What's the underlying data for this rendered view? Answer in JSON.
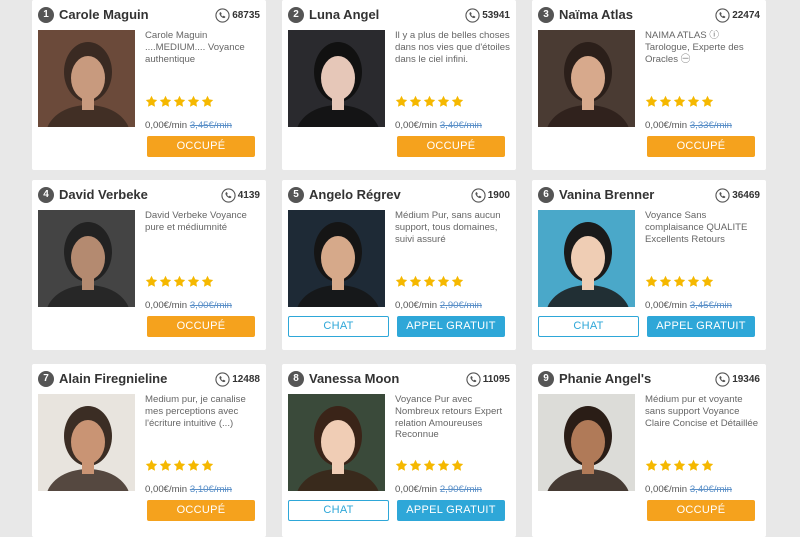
{
  "colors": {
    "busy": "#f5a21d",
    "free": "#2ea7d8",
    "star": "#f5b800",
    "old_price": "#5b90c8"
  },
  "icons": {
    "calls": "phone-icon",
    "rating": "star-icon",
    "rank": "rank-badge"
  },
  "cards": [
    {
      "rank": "1",
      "name": "Carole Maguin",
      "calls": "68735",
      "desc": "Carole Maguin ....MEDIUM.... Voyance authentique",
      "rating": 5,
      "price": "0,00€/min",
      "old_price": "3,45€/min",
      "status": "busy",
      "busy_label": "OCCUPÉ",
      "chat_label": "",
      "free_label": ""
    },
    {
      "rank": "2",
      "name": "Luna Angel",
      "calls": "53941",
      "desc": "Il y a plus de belles choses dans nos vies que d'étoiles dans le ciel infini.",
      "rating": 5,
      "price": "0,00€/min",
      "old_price": "3,40€/min",
      "status": "busy",
      "busy_label": "OCCUPÉ",
      "chat_label": "",
      "free_label": ""
    },
    {
      "rank": "3",
      "name": "Naïma Atlas",
      "calls": "22474",
      "desc": "NAIMA ATLAS ⓘ Tarologue, Experte des Oracles ㊀",
      "rating": 5,
      "price": "0,00€/min",
      "old_price": "3,33€/min",
      "status": "busy",
      "busy_label": "OCCUPÉ",
      "chat_label": "",
      "free_label": ""
    },
    {
      "rank": "4",
      "name": "David Verbeke",
      "calls": "4139",
      "desc": "David Verbeke Voyance pure et médiumnité",
      "rating": 5,
      "price": "0,00€/min",
      "old_price": "3,00€/min",
      "status": "busy",
      "busy_label": "OCCUPÉ",
      "chat_label": "",
      "free_label": ""
    },
    {
      "rank": "5",
      "name": "Angelo Régrev",
      "calls": "1900",
      "desc": "Médium Pur, sans aucun support, tous domaines, suivi assuré",
      "rating": 5,
      "price": "0,00€/min",
      "old_price": "2,90€/min",
      "status": "available",
      "busy_label": "",
      "chat_label": "CHAT",
      "free_label": "APPEL GRATUIT"
    },
    {
      "rank": "6",
      "name": "Vanina Brenner",
      "calls": "36469",
      "desc": "Voyance Sans complaisance QUALITE Excellents Retours",
      "rating": 5,
      "price": "0,00€/min",
      "old_price": "3,45€/min",
      "status": "available",
      "busy_label": "",
      "chat_label": "CHAT",
      "free_label": "APPEL GRATUIT"
    },
    {
      "rank": "7",
      "name": "Alain Firegnieline",
      "calls": "12488",
      "desc": "Medium pur, je canalise mes perceptions avec l'écriture intuitive (...)",
      "rating": 5,
      "price": "0,00€/min",
      "old_price": "3,10€/min",
      "status": "busy",
      "busy_label": "OCCUPÉ",
      "chat_label": "",
      "free_label": ""
    },
    {
      "rank": "8",
      "name": "Vanessa Moon",
      "calls": "11095",
      "desc": "Voyance Pur avec Nombreux retours Expert relation Amoureuses Reconnue",
      "rating": 5,
      "price": "0,00€/min",
      "old_price": "2,90€/min",
      "status": "available",
      "busy_label": "",
      "chat_label": "CHAT",
      "free_label": "APPEL GRATUIT"
    },
    {
      "rank": "9",
      "name": "Phanie Angel's",
      "calls": "19346",
      "desc": "Médium pur et voyante sans support Voyance Claire Concise et Détaillée",
      "rating": 5,
      "price": "0,00€/min",
      "old_price": "3,40€/min",
      "status": "busy",
      "busy_label": "OCCUPÉ",
      "chat_label": "",
      "free_label": ""
    }
  ]
}
